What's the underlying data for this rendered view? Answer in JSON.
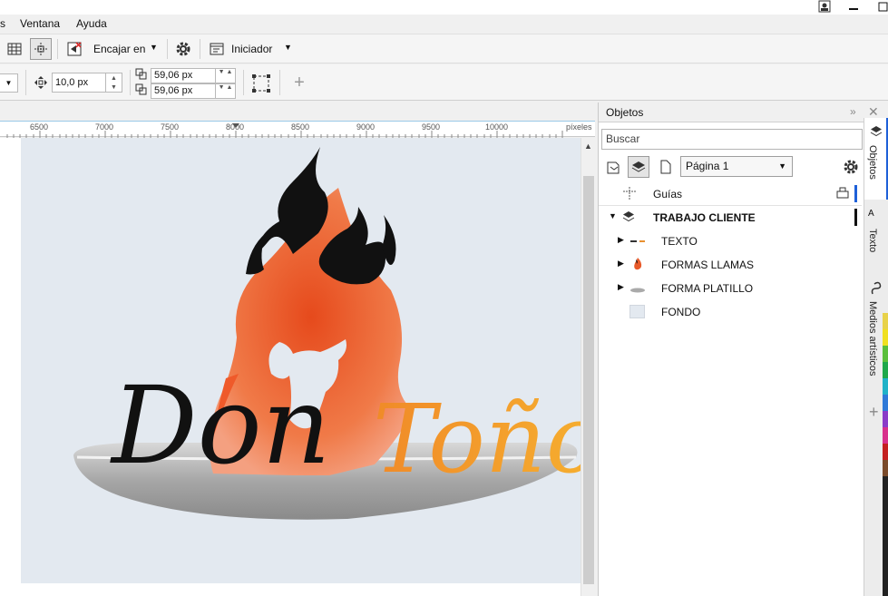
{
  "menu": {
    "items_partial": "s",
    "window_prefix": "Ventana",
    "help_label": "Ayuda"
  },
  "toolbar1": {
    "snap_label": "Encajar en",
    "snap_underline": "e",
    "launcher_label": "Iniciador"
  },
  "toolbar2": {
    "nudge_value": "10,0 px",
    "dup_x_value": "59,06 px",
    "dup_y_value": "59,06 px"
  },
  "ruler": {
    "ticks": [
      "6500",
      "7000",
      "7500",
      "8000",
      "8500",
      "9000",
      "9500",
      "10000"
    ],
    "unit": "píxeles"
  },
  "artwork": {
    "word1": "Don",
    "word2": "Toño"
  },
  "objects_panel": {
    "title": "Objetos",
    "search_placeholder": "Buscar",
    "page_selector": "Página 1",
    "guides_label": "Guías",
    "layer_name": "TRABAJO CLIENTE",
    "sublayers": [
      "TEXTO",
      "FORMAS LLAMAS",
      "FORMA PLATILLO",
      "FONDO"
    ]
  },
  "side_tabs": [
    "Objetos",
    "Texto",
    "Medios artísticos"
  ],
  "colors": {
    "accent_blue": "#1e60d8",
    "flame_orange": "#ec5a2a",
    "palette": [
      "#e8d24a",
      "#f0e020",
      "#5bbf3b",
      "#1ea84a",
      "#20b2c8",
      "#2f7ad8",
      "#8a3bc8",
      "#d8308c",
      "#c42020",
      "#7a4a2a",
      "#222222"
    ]
  }
}
